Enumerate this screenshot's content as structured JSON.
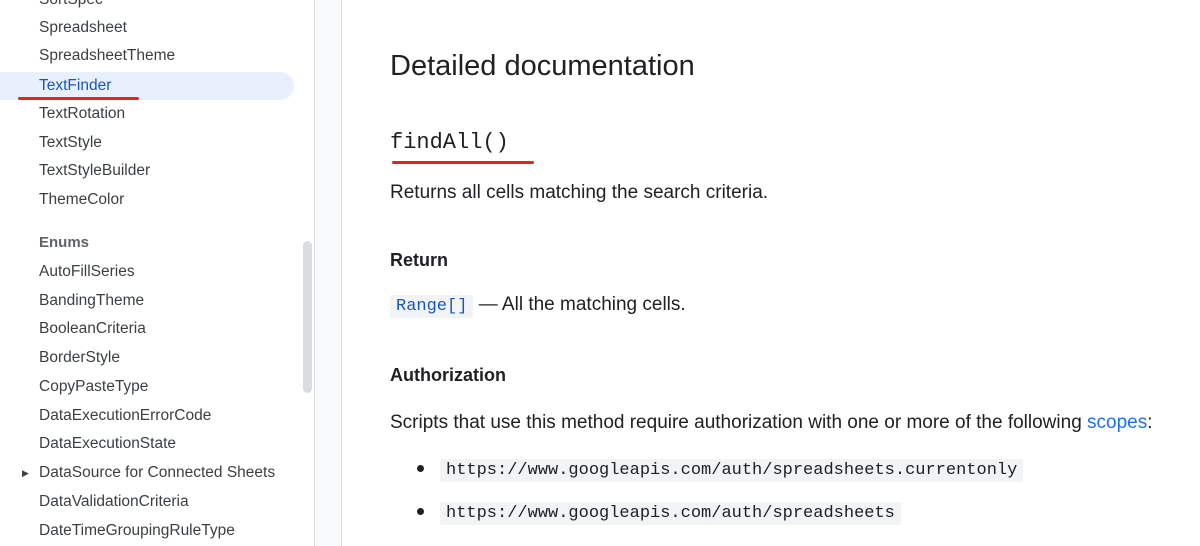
{
  "sidebar": {
    "items_top": [
      {
        "label": "SortSpec"
      },
      {
        "label": "Spreadsheet"
      },
      {
        "label": "SpreadsheetTheme"
      },
      {
        "label": "TextFinder",
        "selected": true
      },
      {
        "label": "TextRotation"
      },
      {
        "label": "TextStyle"
      },
      {
        "label": "TextStyleBuilder"
      },
      {
        "label": "ThemeColor"
      }
    ],
    "enums_heading": "Enums",
    "items_enums": [
      {
        "label": "AutoFillSeries"
      },
      {
        "label": "BandingTheme"
      },
      {
        "label": "BooleanCriteria"
      },
      {
        "label": "BorderStyle"
      },
      {
        "label": "CopyPasteType"
      },
      {
        "label": "DataExecutionErrorCode"
      },
      {
        "label": "DataExecutionState"
      },
      {
        "label": "DataSource for Connected Sheets",
        "expandable": true
      },
      {
        "label": "DataValidationCriteria"
      },
      {
        "label": "DateTimeGroupingRuleType"
      }
    ]
  },
  "main": {
    "title": "Detailed documentation",
    "method_name": "findAll()",
    "description": "Returns all cells matching the search criteria.",
    "return_heading": "Return",
    "return_type": "Range[]",
    "return_desc": " — All the matching cells.",
    "auth_heading": "Authorization",
    "auth_text": "Scripts that use this method require authorization with one or more of the following ",
    "auth_link": "scopes",
    "auth_suffix": ":",
    "scopes": [
      "https://www.googleapis.com/auth/spreadsheets.currentonly",
      "https://www.googleapis.com/auth/spreadsheets"
    ]
  },
  "colors": {
    "selected_bg": "#e8f0fe",
    "selected_text": "#1a56b5",
    "link": "#1a73e8",
    "annotation": "#e5202a"
  },
  "icons": {
    "expand": "chevron-right-icon"
  }
}
